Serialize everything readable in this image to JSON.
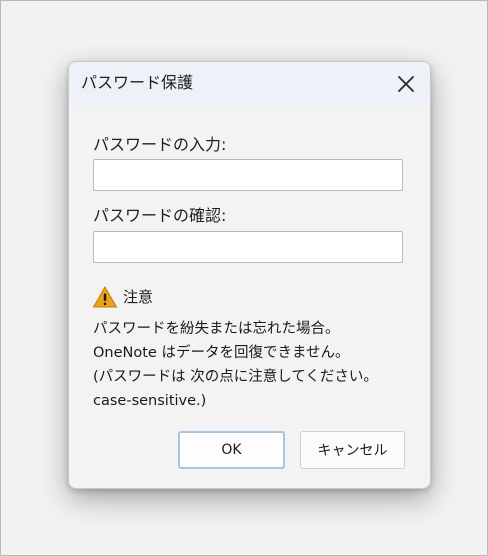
{
  "dialog": {
    "title": "パスワード保護",
    "close_icon": "close-icon",
    "password_label": "パスワードの入力:",
    "password_value": "",
    "confirm_label": "パスワードの確認:",
    "confirm_value": "",
    "warning": {
      "icon": "warning-icon",
      "label": "注意",
      "icon_color": "#e8a317"
    },
    "message_lines": [
      "パスワードを紛失または忘れた場合。",
      "OneNote はデータを回復できません。",
      "(パスワードは 次の点に注意してください。",
      "case-sensitive.)"
    ],
    "buttons": {
      "ok_label": "OK",
      "cancel_label": "キャンセル"
    }
  }
}
